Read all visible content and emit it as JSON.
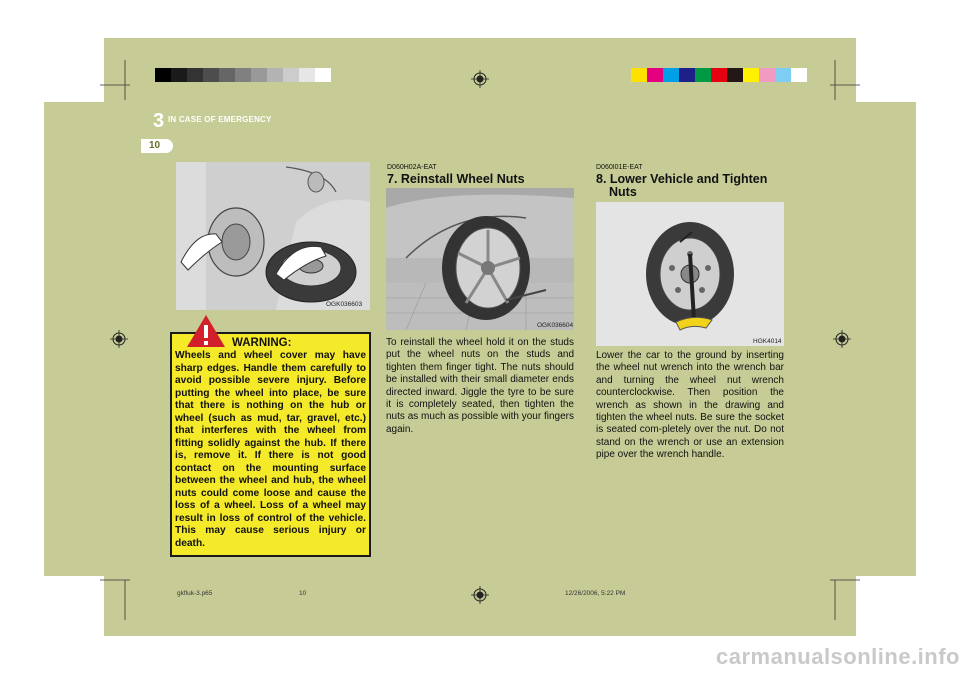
{
  "header": {
    "chapter_number": "3",
    "chapter_title": "IN CASE OF EMERGENCY",
    "page_number": "10"
  },
  "figures": {
    "fig1_code": "OGK036603",
    "fig2_code": "OGK036604",
    "fig3_code": "HGK4014"
  },
  "warning": {
    "title": "WARNING:",
    "text": "Wheels and wheel cover may have sharp edges. Handle them carefully to avoid possible severe injury. Before putting the wheel into place, be sure that there is nothing on the hub or wheel (such as mud, tar, gravel, etc.) that interferes with the wheel from fitting solidly against the hub. If there is, remove it. If there is not good contact on the mounting surface between the wheel and hub, the wheel nuts could come loose and cause the loss of a wheel. Loss of a wheel may result in loss of control of the vehicle. This may cause serious injury or death."
  },
  "section7": {
    "code": "D060H02A-EAT",
    "title": "7. Reinstall Wheel Nuts",
    "body": "To reinstall the wheel  hold it on the studs put the wheel nuts on the studs and tighten them finger tight. The nuts should be installed with their small diameter ends directed inward. Jiggle the tyre to be sure it is completely seated, then tighten the nuts as much as possible with your fingers again."
  },
  "section8": {
    "code": "D060I01E-EAT",
    "title_line1": "8. Lower Vehicle and Tighten",
    "title_line2": "Nuts",
    "body": "Lower the car to the ground by inserting the wheel nut wrench into the wrench bar and turning the wheel nut wrench counterclockwise. Then position the wrench as shown in the drawing and tighten the wheel nuts. Be sure the socket is seated com-pletely over the nut. Do not stand on the wrench or use an extension pipe over the wrench handle."
  },
  "footer": {
    "file": "gkfluk-3.p65",
    "page": "10",
    "datetime": "12/26/2006, 5:22 PM"
  },
  "watermark": "carmanualsonline.info",
  "colors": {
    "page_bg": "#c7cc96",
    "warning_bg": "#f5ea2a",
    "warning_icon": "#d21f2c"
  }
}
